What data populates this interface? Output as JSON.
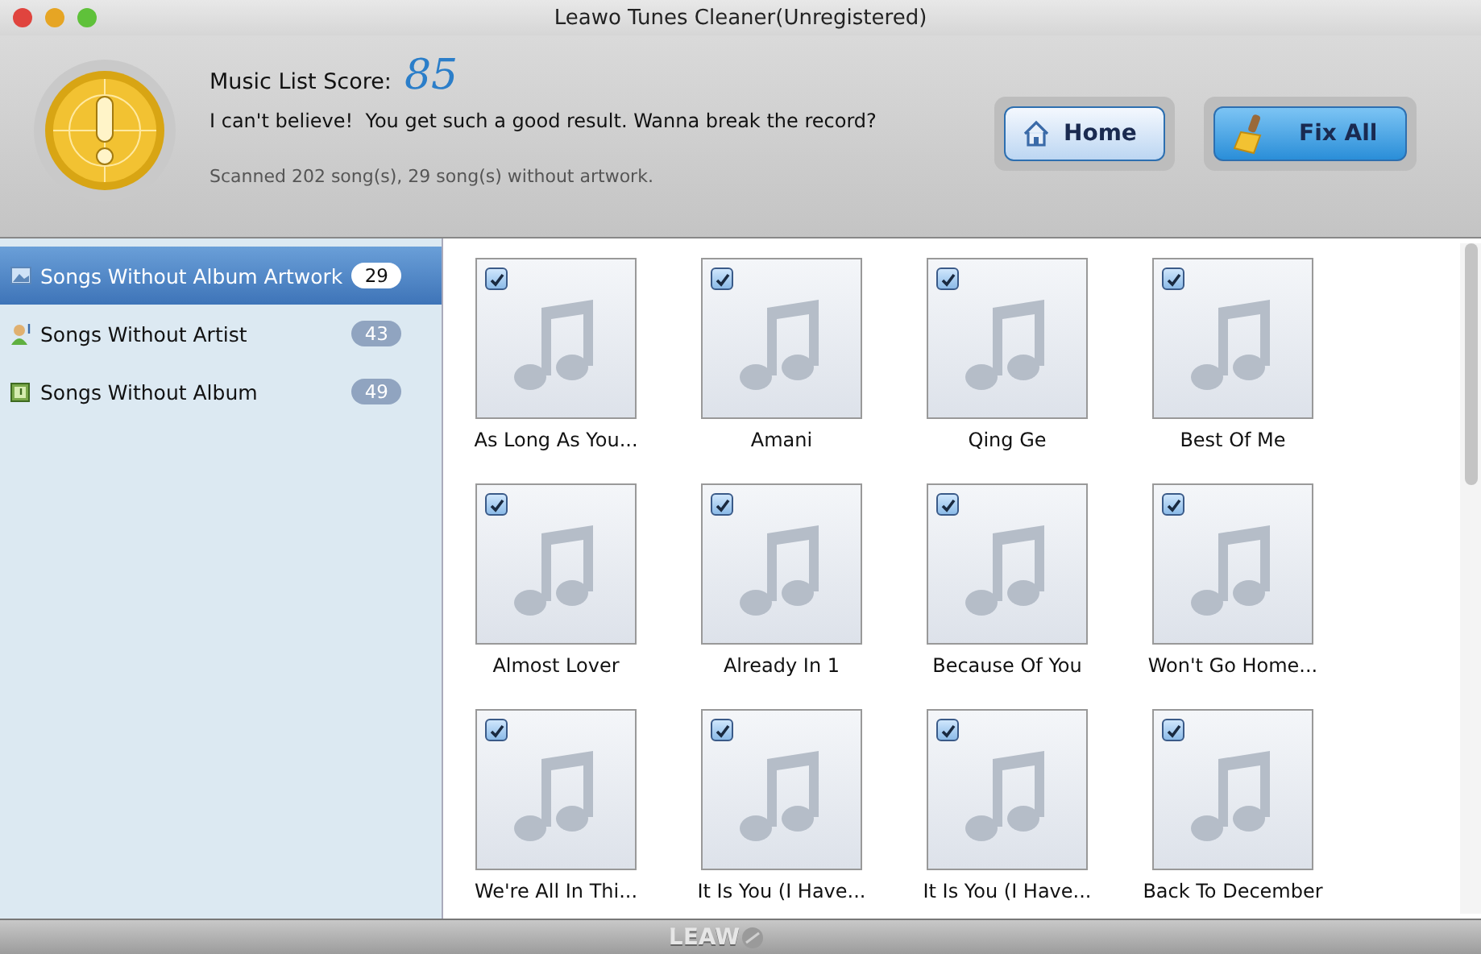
{
  "window": {
    "title": "Leawo Tunes Cleaner(Unregistered)"
  },
  "header": {
    "score_label": "Music List Score:",
    "score": "85",
    "message": "I can't believe!  You get such a good result. Wanna break the record?",
    "summary": "Scanned 202 song(s), 29 song(s) without artwork.",
    "buttons": [
      {
        "kind": "home",
        "label": "Home"
      },
      {
        "kind": "fix",
        "label": "Fix All"
      }
    ]
  },
  "sidebar": {
    "items": [
      {
        "kind": "artwork",
        "label": "Songs Without Album Artwork",
        "count": "29",
        "selected": true
      },
      {
        "kind": "artist",
        "label": "Songs Without Artist",
        "count": "43",
        "selected": false
      },
      {
        "kind": "album",
        "label": "Songs Without Album",
        "count": "49",
        "selected": false
      }
    ]
  },
  "songs": [
    {
      "title": "As Long As You...",
      "checked": true
    },
    {
      "title": "Amani",
      "checked": true
    },
    {
      "title": "Qing Ge",
      "checked": true
    },
    {
      "title": "Best Of Me",
      "checked": true
    },
    {
      "title": "Almost Lover",
      "checked": true
    },
    {
      "title": "Already In 1",
      "checked": true
    },
    {
      "title": "Because Of You",
      "checked": true
    },
    {
      "title": "Won't Go Home...",
      "checked": true
    },
    {
      "title": "We're All In Thi...",
      "checked": true
    },
    {
      "title": "It Is You (I Have...",
      "checked": true
    },
    {
      "title": "It Is You (I Have...",
      "checked": true
    },
    {
      "title": "Back To December",
      "checked": true
    }
  ],
  "footer": {
    "logo": "LEAW"
  }
}
